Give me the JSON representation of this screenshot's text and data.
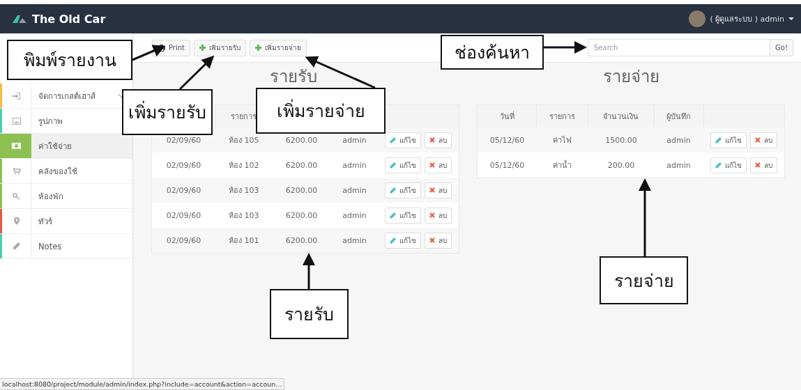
{
  "topbar": {
    "brand": "The Old Car",
    "user": "( ผู้ดูแลระบบ ) admin"
  },
  "sidebar": {
    "items": [
      {
        "label": "จัดการเกสต์เฮาส์",
        "color": "#f6bb42",
        "selected": false,
        "expandable": true
      },
      {
        "label": "รูปภาพ",
        "color": "#48cfad",
        "selected": false,
        "expandable": false
      },
      {
        "label": "ค่าใช้จ่าย",
        "color": "#8cc152",
        "selected": true,
        "expandable": false
      },
      {
        "label": "คลังของใช้",
        "color": "#8cc152",
        "selected": false,
        "expandable": false
      },
      {
        "label": "ห้องพัก",
        "color": "#8cc152",
        "selected": false,
        "expandable": false
      },
      {
        "label": "ทัวร์",
        "color": "#e9573f",
        "selected": false,
        "expandable": false
      },
      {
        "label": "Notes",
        "color": "#48cfad",
        "selected": false,
        "expandable": false
      }
    ]
  },
  "toolbar": {
    "buttons": [
      "Print",
      "เพิ่มรายรับ",
      "เพิ่มรายจ่าย"
    ],
    "search": {
      "placeholder": "Search",
      "button": "Go!"
    }
  },
  "income": {
    "title": "รายรับ",
    "columns": [
      null,
      "รายการ",
      null,
      null
    ],
    "rows": [
      {
        "cells": [
          "02/09/60",
          "ห้อง 105",
          "6200.00",
          "admin"
        ],
        "edit": "แก้ไข",
        "delete": "ลบ"
      },
      {
        "cells": [
          "02/09/60",
          "ห้อง 102",
          "6200.00",
          "admin"
        ],
        "edit": "แก้ไข",
        "delete": "ลบ"
      },
      {
        "cells": [
          "02/09/60",
          "ห้อง 103",
          "6200.00",
          "admin"
        ],
        "edit": "แก้ไข",
        "delete": "ลบ"
      },
      {
        "cells": [
          "02/09/60",
          "ห้อง 103",
          "6200.00",
          "admin"
        ],
        "edit": "แก้ไข",
        "delete": "ลบ"
      },
      {
        "cells": [
          "02/09/60",
          "ห้อง 101",
          "6200.00",
          "admin"
        ],
        "edit": "แก้ไข",
        "delete": "ลบ"
      }
    ]
  },
  "expense": {
    "title": "รายจ่าย",
    "columns": [
      "วันที่",
      "รายการ",
      "จำนวนเงิน",
      "ผู้บันทึก"
    ],
    "rows": [
      {
        "cells": [
          "05/12/60",
          "ค่าไฟ",
          "1500.00",
          "admin"
        ],
        "edit": "แก้ไข",
        "delete": "ลบ"
      },
      {
        "cells": [
          "05/12/60",
          "ค่าน้ำ",
          "200.00",
          "admin"
        ],
        "edit": "แก้ไข",
        "delete": "ลบ"
      }
    ]
  },
  "status_bar": {
    "url": "localhost:8080/project/module/admin/index.php?include=account&action=accoun..."
  },
  "annotations": [
    {
      "text": "พิมพ์รายงาน"
    },
    {
      "text": "เพิ่มรายรับ"
    },
    {
      "text": "เพิ่มรายจ่าย"
    },
    {
      "text": "ช่องค้นหา"
    },
    {
      "text": "รายรับ"
    },
    {
      "text": "รายจ่าย"
    }
  ]
}
